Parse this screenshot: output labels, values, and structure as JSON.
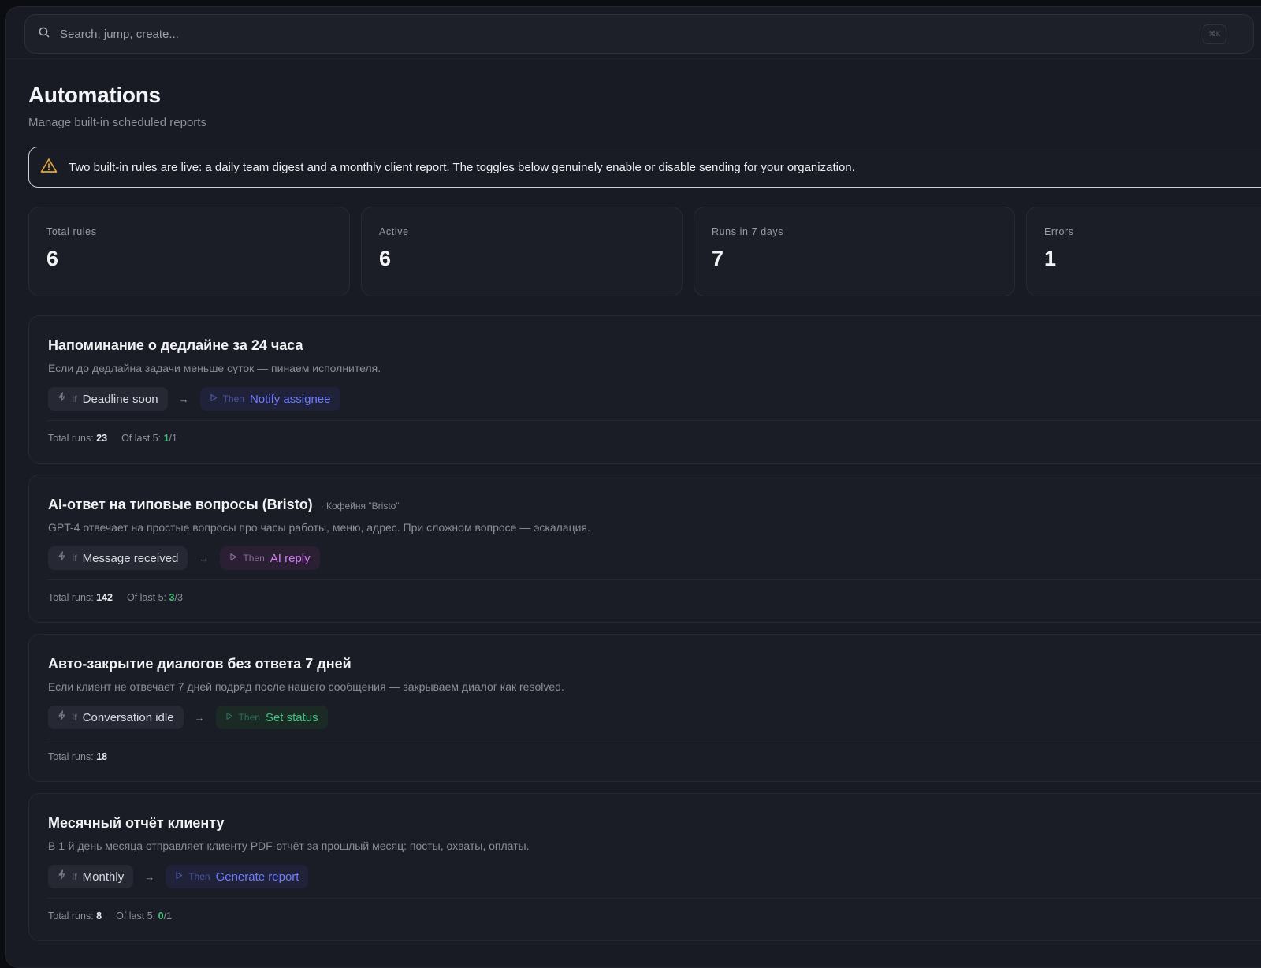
{
  "search": {
    "placeholder": "Search, jump, create...",
    "shortcut": "⌘K"
  },
  "page": {
    "title": "Automations",
    "subtitle": "Manage built-in scheduled reports"
  },
  "banner": {
    "text": "Two built-in rules are live: a daily team digest and a monthly client report. The toggles below genuinely enable or disable sending for your organization."
  },
  "stats": [
    {
      "label": "Total rules",
      "value": "6"
    },
    {
      "label": "Active",
      "value": "6"
    },
    {
      "label": "Runs in 7 days",
      "value": "7"
    },
    {
      "label": "Errors",
      "value": "1"
    }
  ],
  "rules": [
    {
      "title": "Напоминание о дедлайне за 24 часа",
      "context": "",
      "description": "Если до дедлайна задачи меньше суток — пинаем исполнителя.",
      "if_keyword": "If",
      "trigger": "Deadline soon",
      "then_keyword": "Then",
      "action": "Notify assignee",
      "action_color": "#6e7bff",
      "total_runs_label": "Total runs:",
      "total_runs": "23",
      "last5_label": "Of last 5:",
      "last5_ok": "1",
      "last5_total": "/1"
    },
    {
      "title": "AI-ответ на типовые вопросы (Bristo)",
      "context": "· Кофейня \"Bristo\"",
      "description": "GPT-4 отвечает на простые вопросы про часы работы, меню, адрес. При сложном вопросе — эскалация.",
      "if_keyword": "If",
      "trigger": "Message received",
      "then_keyword": "Then",
      "action": "AI reply",
      "action_color": "#d57cf5",
      "total_runs_label": "Total runs:",
      "total_runs": "142",
      "last5_label": "Of last 5:",
      "last5_ok": "3",
      "last5_total": "/3"
    },
    {
      "title": "Авто-закрытие диалогов без ответа 7 дней",
      "context": "",
      "description": "Если клиент не отвечает 7 дней подряд после нашего сообщения — закрываем диалог как resolved.",
      "if_keyword": "If",
      "trigger": "Conversation idle",
      "then_keyword": "Then",
      "action": "Set status",
      "action_color": "#41c27f",
      "total_runs_label": "Total runs:",
      "total_runs": "18"
    },
    {
      "title": "Месячный отчёт клиенту",
      "context": "",
      "description": "В 1-й день месяца отправляет клиенту PDF-отчёт за прошлый месяц: посты, охваты, оплаты.",
      "if_keyword": "If",
      "trigger": "Monthly",
      "then_keyword": "Then",
      "action": "Generate report",
      "action_color": "#6e7bff",
      "total_runs_label": "Total runs:",
      "total_runs": "8",
      "last5_label": "Of last 5:",
      "last5_ok": "0",
      "last5_total": "/1"
    }
  ]
}
